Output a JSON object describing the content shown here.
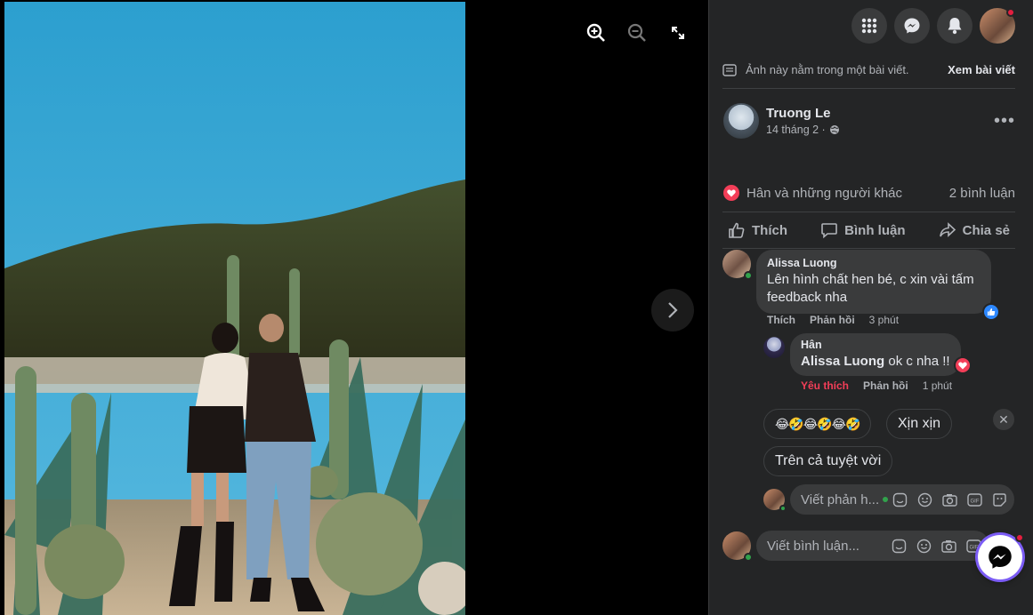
{
  "post_note": {
    "text": "Ảnh này nằm trong một bài viết.",
    "link": "Xem bài viết"
  },
  "author": {
    "name": "Truong Le",
    "date": "14 tháng 2 ·"
  },
  "reactions": {
    "summary": "Hân và những người khác",
    "comments": "2 bình luận"
  },
  "actions": {
    "like": "Thích",
    "comment": "Bình luận",
    "share": "Chia sẻ"
  },
  "comments": [
    {
      "name": "Alissa Luong",
      "text_line1": "Lên hình chất hen bé, c xin vài tấm",
      "text_line2": "feedback nha",
      "like": "Thích",
      "reply": "Phản hồi",
      "time": "3 phút"
    },
    {
      "name": "Hân",
      "mention": "Alissa Luong",
      "text": "ok c nha !!",
      "like": "Yêu thích",
      "reply": "Phản hồi",
      "time": "1 phút"
    }
  ],
  "suggestions": {
    "emoji": "😂🤣😂🤣😂🤣",
    "chip2": "Xịn xịn",
    "chip3": "Trên cả tuyệt vời"
  },
  "reply_input": {
    "placeholder": "Viết phản h..."
  },
  "comment_input": {
    "placeholder": "Viết bình luận..."
  },
  "colors": {
    "accent_blue": "#2d88ff",
    "love": "#f33e58",
    "online": "#31a24c",
    "notification": "#e41e3f"
  }
}
